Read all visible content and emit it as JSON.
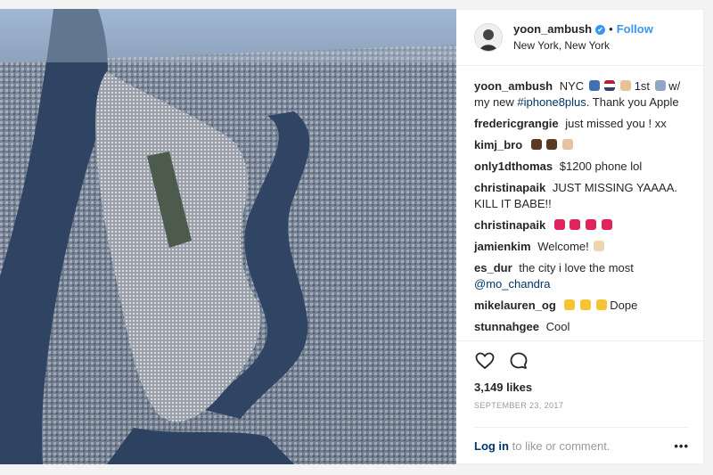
{
  "post": {
    "username": "yoon_ambush",
    "verified_mark": "✔",
    "dot": "•",
    "follow_label": "Follow",
    "location": "New York, New York",
    "image_icon": "aerial-photo-of-manhattan"
  },
  "caption": {
    "username": "yoon_ambush",
    "text_1": "NYC",
    "text_2": "1st",
    "text_3": "w/ my new",
    "hashtag": "#iphone8plus",
    "text_4": ". Thank you Apple"
  },
  "comments": [
    {
      "user": "fredericgrangie",
      "text": "just missed you ! xx"
    },
    {
      "user": "kimj_bro",
      "text": ""
    },
    {
      "user": "only1dthomas",
      "text": "$1200 phone lol"
    },
    {
      "user": "christinapaik",
      "text": "JUST MISSING YAAAA. KILL IT BABE!!"
    },
    {
      "user": "christinapaik",
      "text": ""
    },
    {
      "user": "jamienkim",
      "text": "Welcome!"
    },
    {
      "user": "es_dur",
      "text": "the city i love the most",
      "mention": "@mo_chandra"
    },
    {
      "user": "mikelauren_og",
      "text": "Dope"
    },
    {
      "user": "stunnahgee",
      "text": "Cool"
    }
  ],
  "footer": {
    "likes": "3,149 likes",
    "date": "SEPTEMBER 23, 2017",
    "login_label": "Log in",
    "login_suffix": "to like or comment.",
    "more_label": "•••"
  },
  "colors": {
    "accent": "#3897f0",
    "link": "#003569",
    "border": "#efefef",
    "water": "#2b3f5c"
  }
}
